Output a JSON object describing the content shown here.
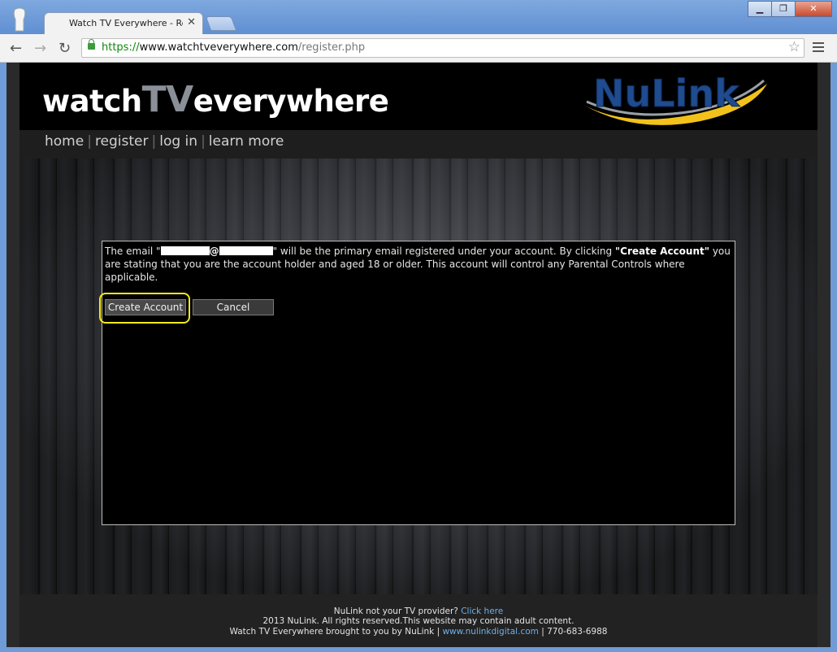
{
  "browser": {
    "tab_title": "Watch TV Everywhere - Regi",
    "tab_close": "✕",
    "window_buttons": {
      "minimize": "▁",
      "maximize": "❐",
      "close": "✕"
    },
    "nav": {
      "back": "←",
      "forward": "→",
      "reload": "↻"
    },
    "url": {
      "scheme": "https://",
      "host": "www.watchtveverywhere.com",
      "path": "/register.php"
    },
    "bookmark_star": "☆"
  },
  "site": {
    "logo_part1": "watch",
    "logo_part2": "TV",
    "logo_part3": "everywhere",
    "partner_logo": "NuLink",
    "nav_items": [
      "home",
      "register",
      "log in",
      "learn more"
    ],
    "nav_separator": "|"
  },
  "dialog": {
    "msg_part1": "The email \"",
    "at_sign": "@",
    "msg_part2": "\" will be the primary email registered under your account. By clicking ",
    "create_quoted": "\"Create Account\"",
    "msg_part3": " you are stating that you are the account holder and aged 18 or older. This account will control any Parental Controls where applicable.",
    "create_button": "Create Account",
    "cancel_button": "Cancel",
    "highlight_color": "#f2ea1c"
  },
  "footer": {
    "line1_text": "NuLink not your TV provider? ",
    "line1_link": "Click here",
    "line2": "2013 NuLink. All rights reserved.This website may contain adult content.",
    "line3_prefix": "Watch TV Everywhere brought to you by NuLink | ",
    "line3_link": "www.nulinkdigital.com",
    "line3_suffix": " | 770-683-6988"
  }
}
